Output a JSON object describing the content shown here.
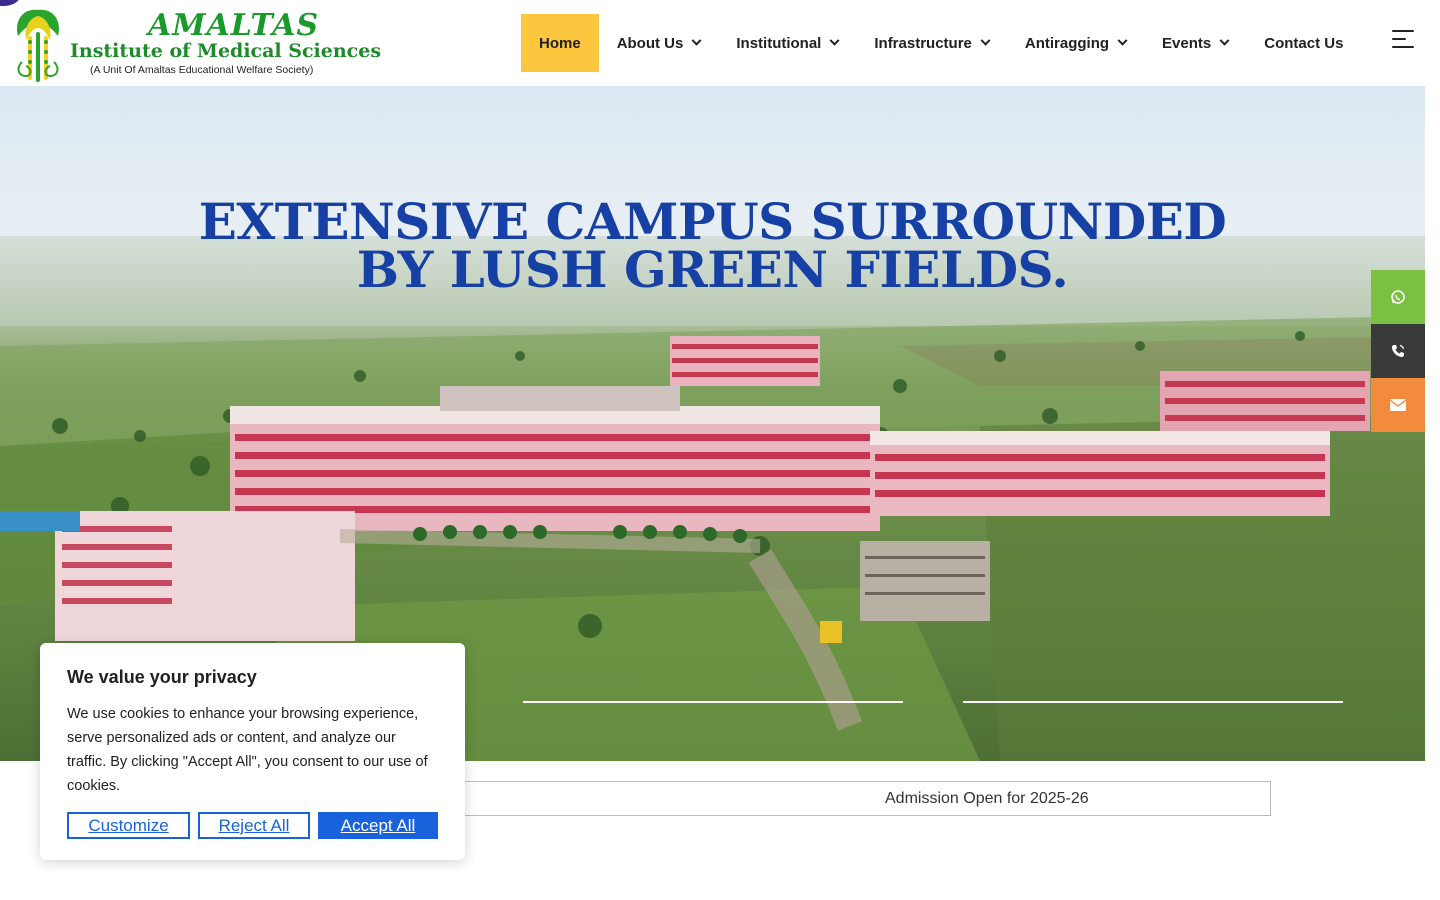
{
  "brand": {
    "name": "AMALTAS",
    "subtitle": "Institute of Medical Sciences",
    "unit": "(A Unit Of Amaltas Educational Welfare Society)"
  },
  "nav": {
    "items": [
      {
        "label": "Home",
        "active": true,
        "dropdown": false
      },
      {
        "label": "About Us",
        "dropdown": true
      },
      {
        "label": "Institutional",
        "dropdown": true
      },
      {
        "label": "Infrastructure",
        "dropdown": true
      },
      {
        "label": "Antiragging",
        "dropdown": true
      },
      {
        "label": "Events",
        "dropdown": true
      },
      {
        "label": "Contact Us",
        "dropdown": false
      }
    ],
    "menu_icon": "hamburger-menu-icon"
  },
  "hero": {
    "line1": "EXTENSIVE CAMPUS SURROUNDED",
    "line2": "BY LUSH GREEN FIELDS."
  },
  "side_buttons": [
    {
      "icon": "whatsapp-icon",
      "color": "#7ac143"
    },
    {
      "icon": "phone-icon",
      "color": "#3a3a3a"
    },
    {
      "icon": "mail-icon",
      "color": "#f28b3c"
    }
  ],
  "marquee": {
    "text": "Admission Open for 2025-26"
  },
  "cookie": {
    "title": "We value your privacy",
    "body": "We use cookies to enhance your browsing experience, serve personalized ads or content, and analyze our traffic. By clicking \"Accept All\", you consent to our use of cookies.",
    "customize": "Customize",
    "reject": "Reject All",
    "accept": "Accept All"
  },
  "colors": {
    "nav_active": "#fcc73e",
    "hero_title": "#1640a3",
    "cookie_accent": "#1863dc"
  }
}
